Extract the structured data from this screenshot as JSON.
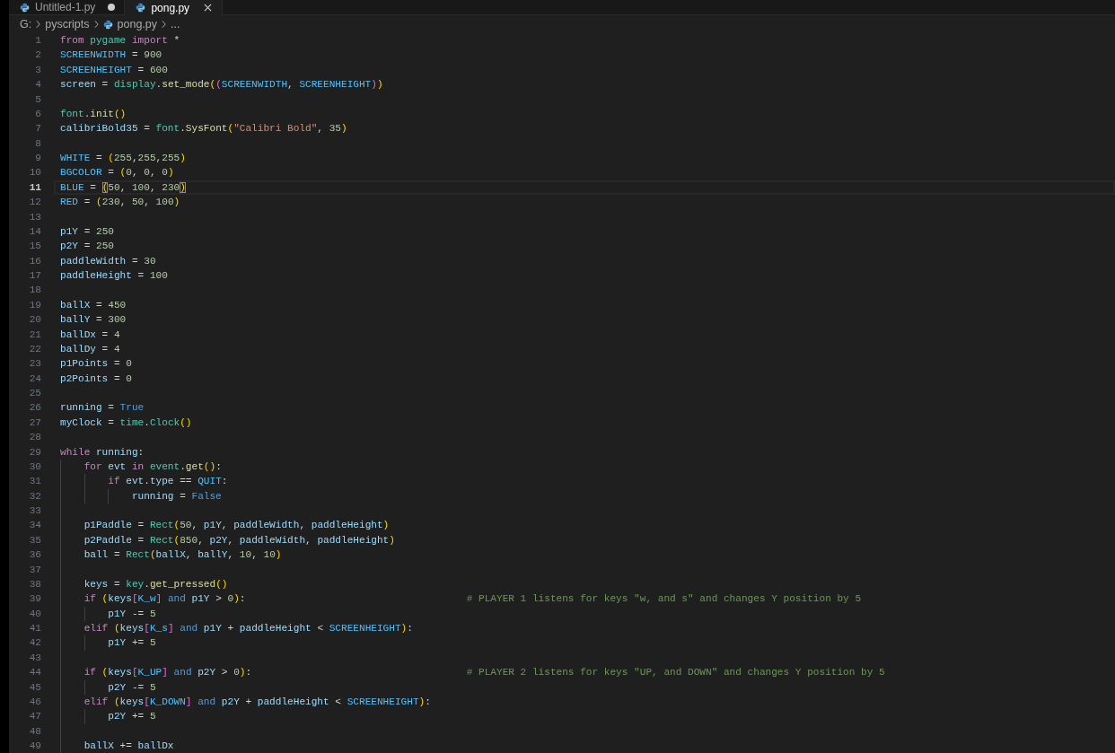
{
  "tabs": [
    {
      "label": "Untitled-1.py",
      "selected": false,
      "modified": true
    },
    {
      "label": "pong.py",
      "selected": true,
      "modified": false
    }
  ],
  "breadcrumbs": [
    {
      "kind": "drive",
      "text": "G:"
    },
    {
      "kind": "folder",
      "text": "pyscripts"
    },
    {
      "kind": "file",
      "text": "pong.py"
    },
    {
      "kind": "more",
      "text": "..."
    }
  ],
  "lines": [
    {
      "number": "1",
      "current": false,
      "tokens": [
        {
          "kind": "keyword",
          "text": "from "
        },
        {
          "kind": "module",
          "text": "pygame"
        },
        {
          "kind": "keyword",
          "text": " import"
        },
        {
          "kind": "plain",
          "text": " *"
        }
      ]
    },
    {
      "number": "2",
      "current": false,
      "tokens": [
        {
          "kind": "constant",
          "text": "SCREENWIDTH"
        },
        {
          "kind": "plain",
          "text": " = "
        },
        {
          "kind": "number",
          "text": "900"
        }
      ]
    },
    {
      "number": "3",
      "current": false,
      "tokens": [
        {
          "kind": "constant",
          "text": "SCREENHEIGHT"
        },
        {
          "kind": "plain",
          "text": " = "
        },
        {
          "kind": "number",
          "text": "600"
        }
      ]
    },
    {
      "number": "4",
      "current": false,
      "tokens": [
        {
          "kind": "variable",
          "text": "screen"
        },
        {
          "kind": "plain",
          "text": " = "
        },
        {
          "kind": "module",
          "text": "display"
        },
        {
          "kind": "plain",
          "text": "."
        },
        {
          "kind": "function",
          "text": "set_mode"
        },
        {
          "kind": "bracket1",
          "text": "("
        },
        {
          "kind": "bracket2",
          "text": "("
        },
        {
          "kind": "constant",
          "text": "SCREENWIDTH"
        },
        {
          "kind": "plain",
          "text": ", "
        },
        {
          "kind": "constant",
          "text": "SCREENHEIGHT"
        },
        {
          "kind": "bracket2",
          "text": ")"
        },
        {
          "kind": "bracket1",
          "text": ")"
        }
      ]
    },
    {
      "number": "5",
      "current": false
    },
    {
      "number": "6",
      "current": false,
      "tokens": [
        {
          "kind": "module",
          "text": "font"
        },
        {
          "kind": "plain",
          "text": "."
        },
        {
          "kind": "function",
          "text": "init"
        },
        {
          "kind": "bracket1",
          "text": "()"
        }
      ]
    },
    {
      "number": "7",
      "current": false,
      "tokens": [
        {
          "kind": "variable",
          "text": "calibriBold35"
        },
        {
          "kind": "plain",
          "text": " = "
        },
        {
          "kind": "module",
          "text": "font"
        },
        {
          "kind": "plain",
          "text": "."
        },
        {
          "kind": "function",
          "text": "SysFont"
        },
        {
          "kind": "bracket1",
          "text": "("
        },
        {
          "kind": "string",
          "text": "\"Calibri Bold\""
        },
        {
          "kind": "plain",
          "text": ", "
        },
        {
          "kind": "number",
          "text": "35"
        },
        {
          "kind": "bracket1",
          "text": ")"
        }
      ]
    },
    {
      "number": "8",
      "current": false
    },
    {
      "number": "9",
      "current": false,
      "tokens": [
        {
          "kind": "constant",
          "text": "WHITE"
        },
        {
          "kind": "plain",
          "text": " = "
        },
        {
          "kind": "bracket1",
          "text": "("
        },
        {
          "kind": "number",
          "text": "255"
        },
        {
          "kind": "plain",
          "text": ","
        },
        {
          "kind": "number",
          "text": "255"
        },
        {
          "kind": "plain",
          "text": ","
        },
        {
          "kind": "number",
          "text": "255"
        },
        {
          "kind": "bracket1",
          "text": ")"
        }
      ]
    },
    {
      "number": "10",
      "current": false,
      "tokens": [
        {
          "kind": "constant",
          "text": "BGCOLOR"
        },
        {
          "kind": "plain",
          "text": " = "
        },
        {
          "kind": "bracket1",
          "text": "("
        },
        {
          "kind": "number",
          "text": "0"
        },
        {
          "kind": "plain",
          "text": ", "
        },
        {
          "kind": "number",
          "text": "0"
        },
        {
          "kind": "plain",
          "text": ", "
        },
        {
          "kind": "number",
          "text": "0"
        },
        {
          "kind": "bracket1",
          "text": ")"
        }
      ]
    },
    {
      "number": "11",
      "current": true,
      "tokens": [
        {
          "kind": "constant",
          "text": "BLUE"
        },
        {
          "kind": "plain",
          "text": " = "
        },
        {
          "kind": "match",
          "text": "("
        },
        {
          "kind": "number",
          "text": "50"
        },
        {
          "kind": "plain",
          "text": ", "
        },
        {
          "kind": "number",
          "text": "100"
        },
        {
          "kind": "plain",
          "text": ", "
        },
        {
          "kind": "number",
          "text": "230"
        },
        {
          "kind": "match",
          "text": ")"
        }
      ]
    },
    {
      "number": "12",
      "current": false,
      "tokens": [
        {
          "kind": "constant",
          "text": "RED"
        },
        {
          "kind": "plain",
          "text": " = "
        },
        {
          "kind": "bracket1",
          "text": "("
        },
        {
          "kind": "number",
          "text": "230"
        },
        {
          "kind": "plain",
          "text": ", "
        },
        {
          "kind": "number",
          "text": "50"
        },
        {
          "kind": "plain",
          "text": ", "
        },
        {
          "kind": "number",
          "text": "100"
        },
        {
          "kind": "bracket1",
          "text": ")"
        }
      ]
    },
    {
      "number": "13",
      "current": false
    },
    {
      "number": "14",
      "current": false,
      "tokens": [
        {
          "kind": "variable",
          "text": "p1Y"
        },
        {
          "kind": "plain",
          "text": " = "
        },
        {
          "kind": "number",
          "text": "250"
        }
      ]
    },
    {
      "number": "15",
      "current": false,
      "tokens": [
        {
          "kind": "variable",
          "text": "p2Y"
        },
        {
          "kind": "plain",
          "text": " = "
        },
        {
          "kind": "number",
          "text": "250"
        }
      ]
    },
    {
      "number": "16",
      "current": false,
      "tokens": [
        {
          "kind": "variable",
          "text": "paddleWidth"
        },
        {
          "kind": "plain",
          "text": " = "
        },
        {
          "kind": "number",
          "text": "30"
        }
      ]
    },
    {
      "number": "17",
      "current": false,
      "tokens": [
        {
          "kind": "variable",
          "text": "paddleHeight"
        },
        {
          "kind": "plain",
          "text": " = "
        },
        {
          "kind": "number",
          "text": "100"
        }
      ]
    },
    {
      "number": "18",
      "current": false
    },
    {
      "number": "19",
      "current": false,
      "tokens": [
        {
          "kind": "variable",
          "text": "ballX"
        },
        {
          "kind": "plain",
          "text": " = "
        },
        {
          "kind": "number",
          "text": "450"
        }
      ]
    },
    {
      "number": "20",
      "current": false,
      "tokens": [
        {
          "kind": "variable",
          "text": "ballY"
        },
        {
          "kind": "plain",
          "text": " = "
        },
        {
          "kind": "number",
          "text": "300"
        }
      ]
    },
    {
      "number": "21",
      "current": false,
      "tokens": [
        {
          "kind": "variable",
          "text": "ballDx"
        },
        {
          "kind": "plain",
          "text": " = "
        },
        {
          "kind": "number",
          "text": "4"
        }
      ]
    },
    {
      "number": "22",
      "current": false,
      "tokens": [
        {
          "kind": "variable",
          "text": "ballDy"
        },
        {
          "kind": "plain",
          "text": " = "
        },
        {
          "kind": "number",
          "text": "4"
        }
      ]
    },
    {
      "number": "23",
      "current": false,
      "tokens": [
        {
          "kind": "variable",
          "text": "p1Points"
        },
        {
          "kind": "plain",
          "text": " = "
        },
        {
          "kind": "number",
          "text": "0"
        }
      ]
    },
    {
      "number": "24",
      "current": false,
      "tokens": [
        {
          "kind": "variable",
          "text": "p2Points"
        },
        {
          "kind": "plain",
          "text": " = "
        },
        {
          "kind": "number",
          "text": "0"
        }
      ]
    },
    {
      "number": "25",
      "current": false
    },
    {
      "number": "26",
      "current": false,
      "tokens": [
        {
          "kind": "variable",
          "text": "running"
        },
        {
          "kind": "plain",
          "text": " = "
        },
        {
          "kind": "logic",
          "text": "True"
        }
      ]
    },
    {
      "number": "27",
      "current": false,
      "tokens": [
        {
          "kind": "variable",
          "text": "myClock"
        },
        {
          "kind": "plain",
          "text": " = "
        },
        {
          "kind": "module",
          "text": "time"
        },
        {
          "kind": "plain",
          "text": "."
        },
        {
          "kind": "module",
          "text": "Clock"
        },
        {
          "kind": "bracket1",
          "text": "()"
        }
      ]
    },
    {
      "number": "28",
      "current": false
    },
    {
      "number": "29",
      "current": false,
      "tokens": [
        {
          "kind": "keyword",
          "text": "while "
        },
        {
          "kind": "variable",
          "text": "running"
        },
        {
          "kind": "plain",
          "text": ":"
        }
      ],
      "children": [
        {
          "number": "30",
          "current": false,
          "tokens": [
            {
              "kind": "keyword",
              "text": "for "
            },
            {
              "kind": "variable",
              "text": "evt"
            },
            {
              "kind": "keyword",
              "text": " in "
            },
            {
              "kind": "module",
              "text": "event"
            },
            {
              "kind": "plain",
              "text": "."
            },
            {
              "kind": "function",
              "text": "get"
            },
            {
              "kind": "bracket1",
              "text": "()"
            },
            {
              "kind": "plain",
              "text": ":"
            }
          ],
          "children": [
            {
              "number": "31",
              "current": false,
              "tokens": [
                {
                  "kind": "keyword",
                  "text": "if "
                },
                {
                  "kind": "variable",
                  "text": "evt"
                },
                {
                  "kind": "plain",
                  "text": "."
                },
                {
                  "kind": "variable",
                  "text": "type"
                },
                {
                  "kind": "plain",
                  "text": " == "
                },
                {
                  "kind": "constant",
                  "text": "QUIT"
                },
                {
                  "kind": "plain",
                  "text": ":"
                }
              ],
              "children": [
                {
                  "number": "32",
                  "current": false,
                  "tokens": [
                    {
                      "kind": "variable",
                      "text": "running"
                    },
                    {
                      "kind": "plain",
                      "text": " = "
                    },
                    {
                      "kind": "logic",
                      "text": "False"
                    }
                  ]
                }
              ]
            }
          ]
        },
        {
          "number": "33",
          "current": false
        },
        {
          "number": "34",
          "current": false,
          "tokens": [
            {
              "kind": "variable",
              "text": "p1Paddle"
            },
            {
              "kind": "plain",
              "text": " = "
            },
            {
              "kind": "module",
              "text": "Rect"
            },
            {
              "kind": "bracket1",
              "text": "("
            },
            {
              "kind": "number",
              "text": "50"
            },
            {
              "kind": "plain",
              "text": ", "
            },
            {
              "kind": "variable",
              "text": "p1Y"
            },
            {
              "kind": "plain",
              "text": ", "
            },
            {
              "kind": "variable",
              "text": "paddleWidth"
            },
            {
              "kind": "plain",
              "text": ", "
            },
            {
              "kind": "variable",
              "text": "paddleHeight"
            },
            {
              "kind": "bracket1",
              "text": ")"
            }
          ]
        },
        {
          "number": "35",
          "current": false,
          "tokens": [
            {
              "kind": "variable",
              "text": "p2Paddle"
            },
            {
              "kind": "plain",
              "text": " = "
            },
            {
              "kind": "module",
              "text": "Rect"
            },
            {
              "kind": "bracket1",
              "text": "("
            },
            {
              "kind": "number",
              "text": "850"
            },
            {
              "kind": "plain",
              "text": ", "
            },
            {
              "kind": "variable",
              "text": "p2Y"
            },
            {
              "kind": "plain",
              "text": ", "
            },
            {
              "kind": "variable",
              "text": "paddleWidth"
            },
            {
              "kind": "plain",
              "text": ", "
            },
            {
              "kind": "variable",
              "text": "paddleHeight"
            },
            {
              "kind": "bracket1",
              "text": ")"
            }
          ]
        },
        {
          "number": "36",
          "current": false,
          "tokens": [
            {
              "kind": "variable",
              "text": "ball"
            },
            {
              "kind": "plain",
              "text": " = "
            },
            {
              "kind": "module",
              "text": "Rect"
            },
            {
              "kind": "bracket1",
              "text": "("
            },
            {
              "kind": "variable",
              "text": "ballX"
            },
            {
              "kind": "plain",
              "text": ", "
            },
            {
              "kind": "variable",
              "text": "ballY"
            },
            {
              "kind": "plain",
              "text": ", "
            },
            {
              "kind": "number",
              "text": "10"
            },
            {
              "kind": "plain",
              "text": ", "
            },
            {
              "kind": "number",
              "text": "10"
            },
            {
              "kind": "bracket1",
              "text": ")"
            }
          ]
        },
        {
          "number": "37",
          "current": false
        },
        {
          "number": "38",
          "current": false,
          "tokens": [
            {
              "kind": "variable",
              "text": "keys"
            },
            {
              "kind": "plain",
              "text": " = "
            },
            {
              "kind": "module",
              "text": "key"
            },
            {
              "kind": "plain",
              "text": "."
            },
            {
              "kind": "function",
              "text": "get_pressed"
            },
            {
              "kind": "bracket1",
              "text": "()"
            }
          ]
        },
        {
          "number": "39",
          "current": false,
          "tokens": [
            {
              "kind": "keyword",
              "text": "if "
            },
            {
              "kind": "bracket1",
              "text": "("
            },
            {
              "kind": "variable",
              "text": "keys"
            },
            {
              "kind": "bracket2",
              "text": "["
            },
            {
              "kind": "constant",
              "text": "K_w"
            },
            {
              "kind": "bracket2",
              "text": "]"
            },
            {
              "kind": "logic",
              "text": " and "
            },
            {
              "kind": "variable",
              "text": "p1Y"
            },
            {
              "kind": "plain",
              "text": " > "
            },
            {
              "kind": "number",
              "text": "0"
            },
            {
              "kind": "bracket1",
              "text": ")"
            },
            {
              "kind": "plain",
              "text": ":"
            }
          ],
          "comment": "# PLAYER 1 listens for keys \"w, and s\" and changes Y position by 5",
          "children": [
            {
              "number": "40",
              "current": false,
              "tokens": [
                {
                  "kind": "variable",
                  "text": "p1Y"
                },
                {
                  "kind": "plain",
                  "text": " -= "
                },
                {
                  "kind": "number",
                  "text": "5"
                }
              ]
            }
          ]
        },
        {
          "number": "41",
          "current": false,
          "tokens": [
            {
              "kind": "keyword",
              "text": "elif "
            },
            {
              "kind": "bracket1",
              "text": "("
            },
            {
              "kind": "variable",
              "text": "keys"
            },
            {
              "kind": "bracket2",
              "text": "["
            },
            {
              "kind": "constant",
              "text": "K_s"
            },
            {
              "kind": "bracket2",
              "text": "]"
            },
            {
              "kind": "logic",
              "text": " and "
            },
            {
              "kind": "variable",
              "text": "p1Y"
            },
            {
              "kind": "plain",
              "text": " + "
            },
            {
              "kind": "variable",
              "text": "paddleHeight"
            },
            {
              "kind": "plain",
              "text": " < "
            },
            {
              "kind": "constant",
              "text": "SCREENHEIGHT"
            },
            {
              "kind": "bracket1",
              "text": ")"
            },
            {
              "kind": "plain",
              "text": ":"
            }
          ],
          "children": [
            {
              "number": "42",
              "current": false,
              "tokens": [
                {
                  "kind": "variable",
                  "text": "p1Y"
                },
                {
                  "kind": "plain",
                  "text": " += "
                },
                {
                  "kind": "number",
                  "text": "5"
                }
              ]
            }
          ]
        },
        {
          "number": "43",
          "current": false
        },
        {
          "number": "44",
          "current": false,
          "tokens": [
            {
              "kind": "keyword",
              "text": "if "
            },
            {
              "kind": "bracket1",
              "text": "("
            },
            {
              "kind": "variable",
              "text": "keys"
            },
            {
              "kind": "bracket2",
              "text": "["
            },
            {
              "kind": "constant",
              "text": "K_UP"
            },
            {
              "kind": "bracket2",
              "text": "]"
            },
            {
              "kind": "logic",
              "text": " and "
            },
            {
              "kind": "variable",
              "text": "p2Y"
            },
            {
              "kind": "plain",
              "text": " > "
            },
            {
              "kind": "number",
              "text": "0"
            },
            {
              "kind": "bracket1",
              "text": ")"
            },
            {
              "kind": "plain",
              "text": ":"
            }
          ],
          "comment": "# PLAYER 2 listens for keys \"UP, and DOWN\" and changes Y position by 5",
          "children": [
            {
              "number": "45",
              "current": false,
              "tokens": [
                {
                  "kind": "variable",
                  "text": "p2Y"
                },
                {
                  "kind": "plain",
                  "text": " -= "
                },
                {
                  "kind": "number",
                  "text": "5"
                }
              ]
            }
          ]
        },
        {
          "number": "46",
          "current": false,
          "tokens": [
            {
              "kind": "keyword",
              "text": "elif "
            },
            {
              "kind": "bracket1",
              "text": "("
            },
            {
              "kind": "variable",
              "text": "keys"
            },
            {
              "kind": "bracket2",
              "text": "["
            },
            {
              "kind": "constant",
              "text": "K_DOWN"
            },
            {
              "kind": "bracket2",
              "text": "]"
            },
            {
              "kind": "logic",
              "text": " and "
            },
            {
              "kind": "variable",
              "text": "p2Y"
            },
            {
              "kind": "plain",
              "text": " + "
            },
            {
              "kind": "variable",
              "text": "paddleHeight"
            },
            {
              "kind": "plain",
              "text": " < "
            },
            {
              "kind": "constant",
              "text": "SCREENHEIGHT"
            },
            {
              "kind": "bracket1",
              "text": ")"
            },
            {
              "kind": "plain",
              "text": ":"
            }
          ],
          "children": [
            {
              "number": "47",
              "current": false,
              "tokens": [
                {
                  "kind": "variable",
                  "text": "p2Y"
                },
                {
                  "kind": "plain",
                  "text": " += "
                },
                {
                  "kind": "number",
                  "text": "5"
                }
              ]
            }
          ]
        },
        {
          "number": "48",
          "current": false
        },
        {
          "number": "49",
          "current": false,
          "tokens": [
            {
              "kind": "variable",
              "text": "ballX"
            },
            {
              "kind": "plain",
              "text": " += "
            },
            {
              "kind": "variable",
              "text": "ballDx"
            }
          ]
        }
      ]
    }
  ]
}
